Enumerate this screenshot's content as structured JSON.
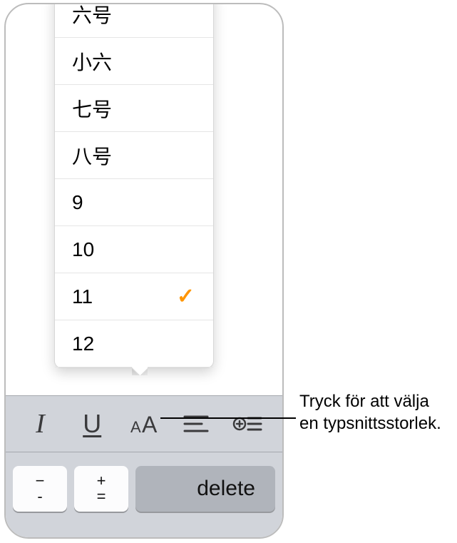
{
  "sizes": {
    "items": [
      {
        "label": "六号",
        "selected": false
      },
      {
        "label": "小六",
        "selected": false
      },
      {
        "label": "七号",
        "selected": false
      },
      {
        "label": "八号",
        "selected": false
      },
      {
        "label": "9",
        "selected": false
      },
      {
        "label": "10",
        "selected": false
      },
      {
        "label": "11",
        "selected": true
      },
      {
        "label": "12",
        "selected": false
      }
    ]
  },
  "toolbar": {
    "italic": "I",
    "underline": "U"
  },
  "keys": {
    "minus_top": "−",
    "minus_bottom": "-",
    "plus": "+",
    "equals": "=",
    "delete": "delete"
  },
  "callout": {
    "text": "Tryck för att välja en typsnittsstorlek."
  }
}
